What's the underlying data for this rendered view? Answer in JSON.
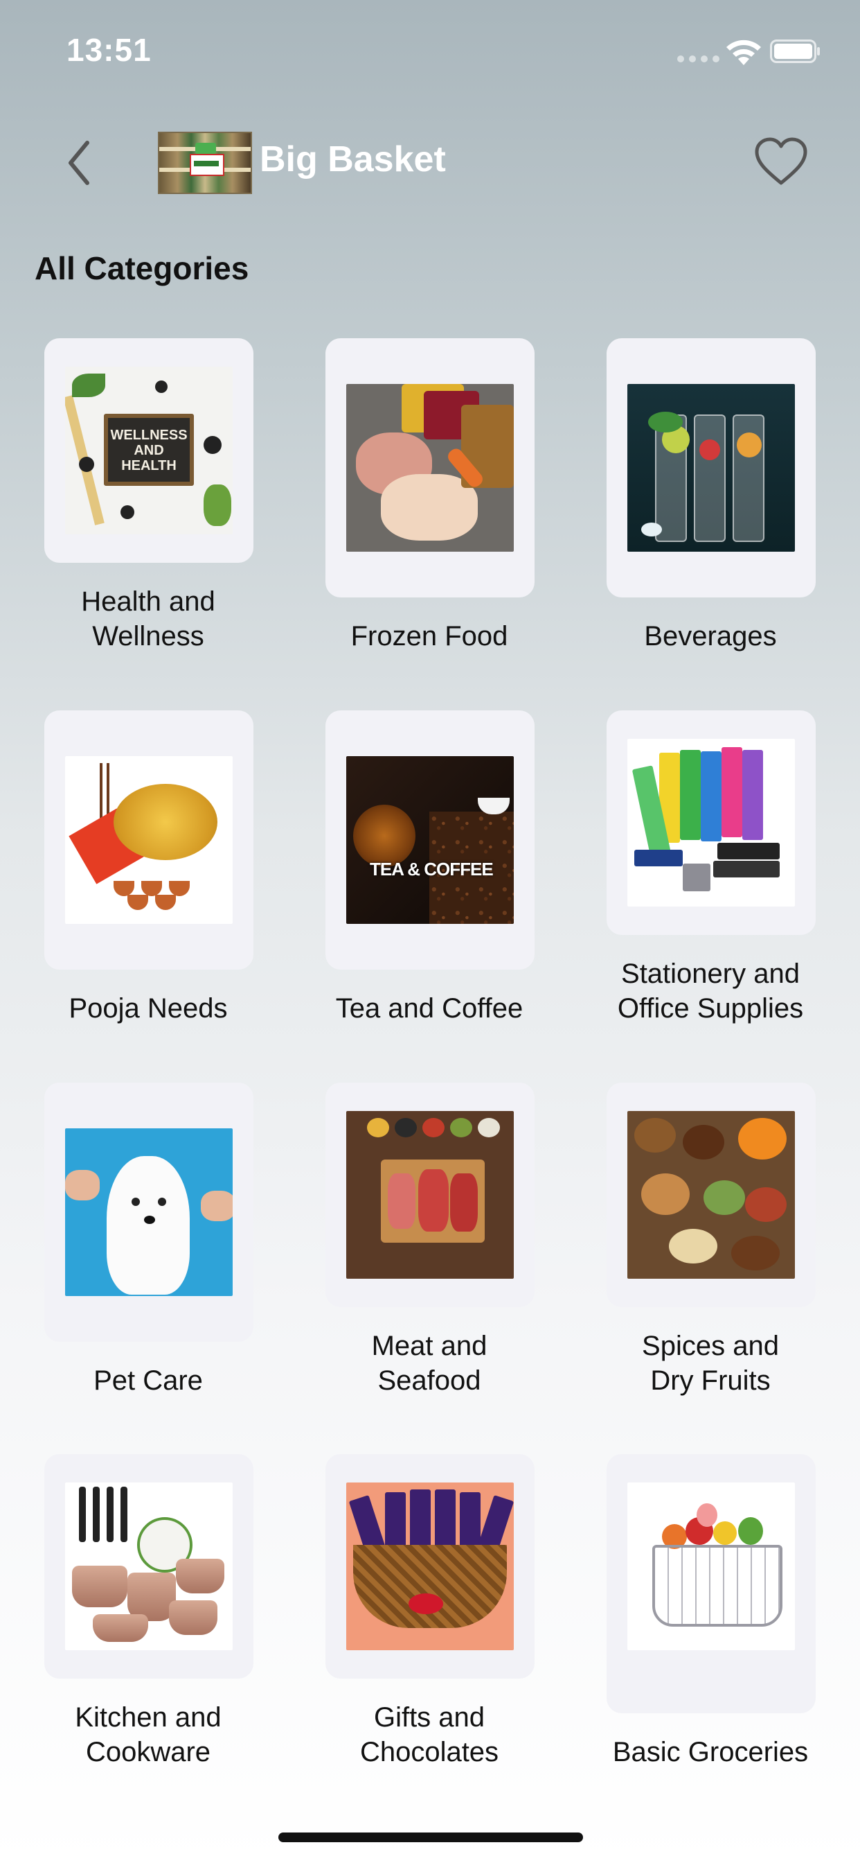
{
  "status_bar": {
    "time": "13:51"
  },
  "nav": {
    "title": "Big Basket"
  },
  "section_title": "All Categories",
  "categories": [
    {
      "label": "Health and\nWellness",
      "thumb_text": "WELLNESS\nAND\nHEALTH"
    },
    {
      "label": "Frozen Food"
    },
    {
      "label": "Beverages"
    },
    {
      "label": "Pooja Needs"
    },
    {
      "label": "Tea and Coffee",
      "thumb_text": "TEA & COFFEE"
    },
    {
      "label": "Stationery and\nOffice Supplies"
    },
    {
      "label": "Pet Care"
    },
    {
      "label": "Meat and\nSeafood"
    },
    {
      "label": "Spices and\nDry Fruits"
    },
    {
      "label": "Kitchen and\nCookware"
    },
    {
      "label": "Gifts and\nChocolates"
    },
    {
      "label": "Basic Groceries"
    }
  ]
}
